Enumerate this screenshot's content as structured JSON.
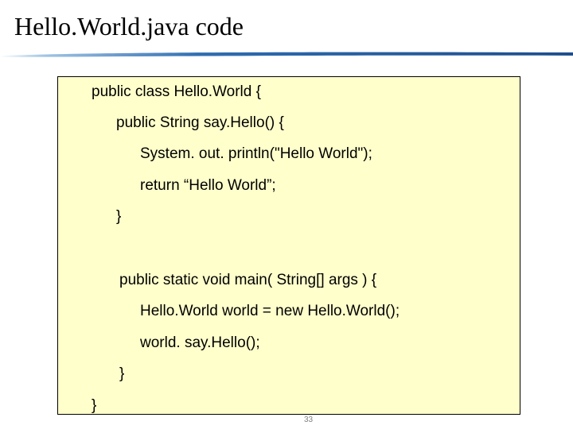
{
  "slide": {
    "title": "Hello.World.java code",
    "page_number": "33"
  },
  "colors": {
    "code_background": "#ffffcc",
    "rule_dark": "#1f4e8c",
    "rule_light": "#9fc3e4"
  },
  "code": {
    "lines": [
      "public class Hello.World {",
      "public String say.Hello() {",
      "System. out. println(\"Hello World\");",
      "return “Hello World”;",
      "}",
      "public static void main( String[] args ) {",
      "Hello.World world = new Hello.World();",
      "world. say.Hello();",
      "}",
      "}"
    ]
  }
}
